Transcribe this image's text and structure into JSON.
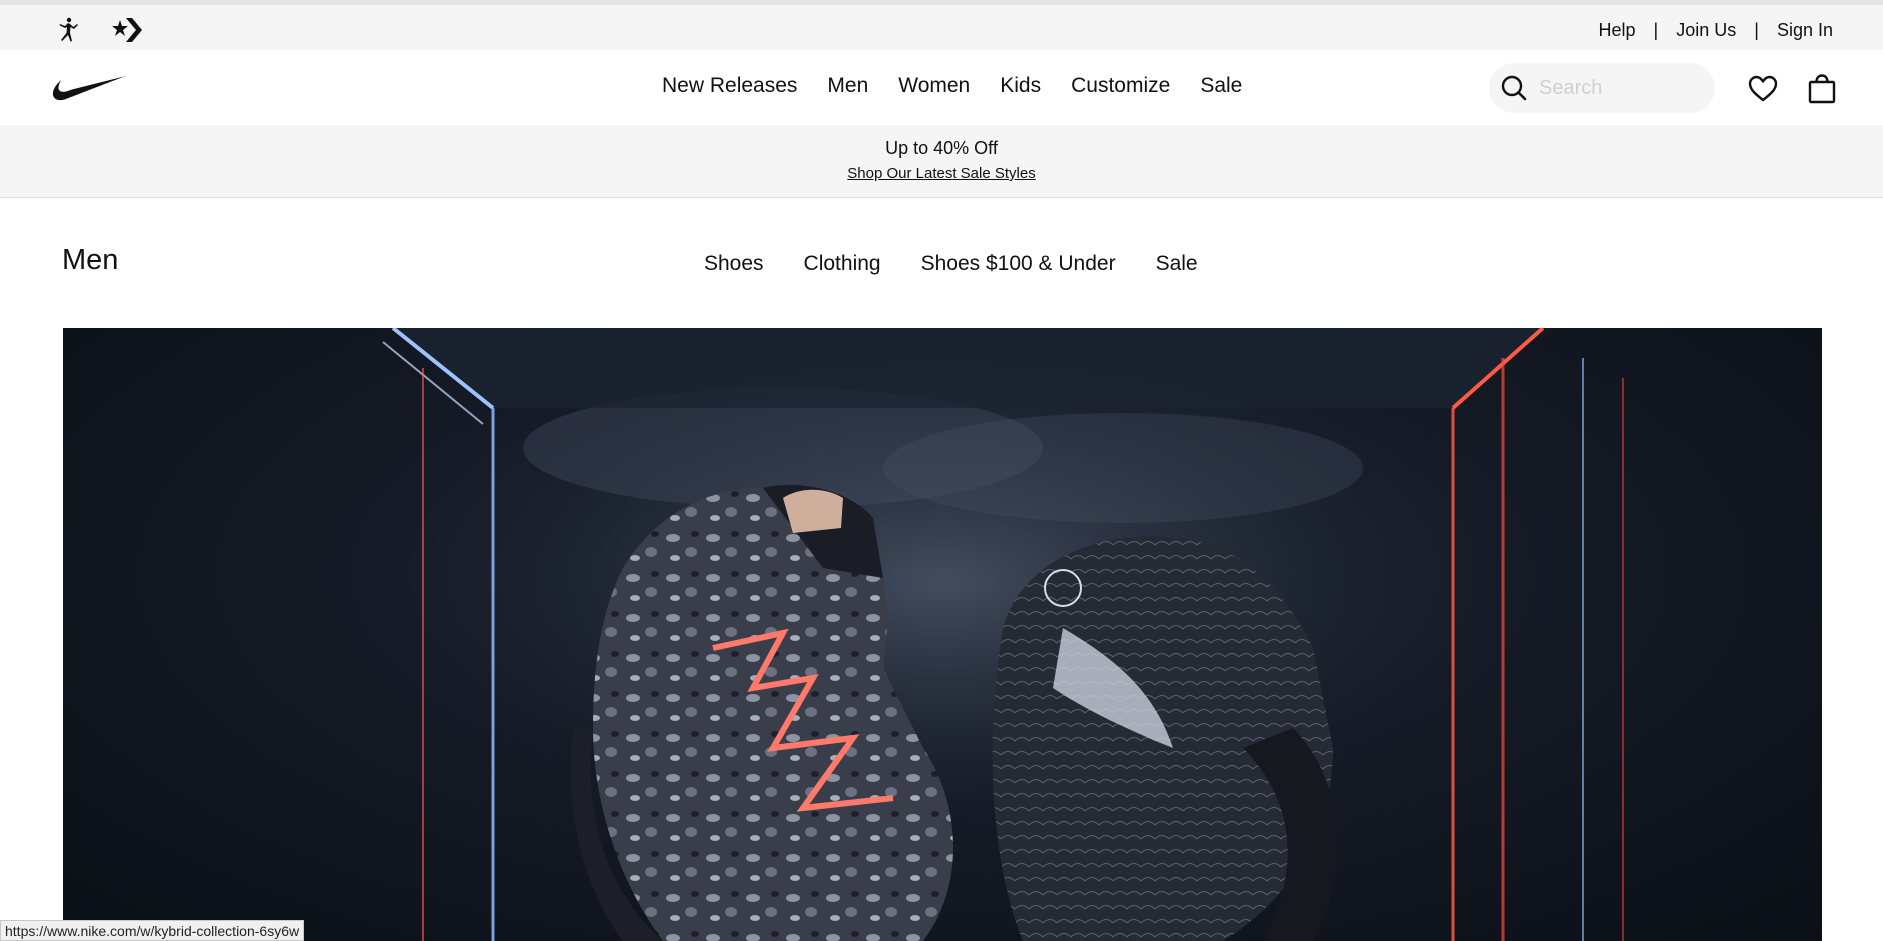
{
  "brand_strip": {
    "icons": [
      "jordan-jumpman-icon",
      "converse-star-chevron-icon"
    ],
    "utility_links": {
      "help": "Help",
      "join": "Join Us",
      "sign_in": "Sign In",
      "separator": "|"
    }
  },
  "main_nav": {
    "logo": "nike-swoosh-icon",
    "items": [
      {
        "label": "New Releases"
      },
      {
        "label": "Men"
      },
      {
        "label": "Women"
      },
      {
        "label": "Kids"
      },
      {
        "label": "Customize"
      },
      {
        "label": "Sale"
      }
    ],
    "search": {
      "placeholder": "Search",
      "value": ""
    },
    "icons": [
      "heart-icon",
      "bag-icon"
    ]
  },
  "promo": {
    "title": "Up to 40% Off",
    "link": "Shop Our Latest Sale Styles"
  },
  "sub_header": {
    "title": "Men",
    "items": [
      {
        "label": "Shoes"
      },
      {
        "label": "Clothing"
      },
      {
        "label": "Shoes $100 & Under"
      },
      {
        "label": "Sale"
      }
    ]
  },
  "status_bar": {
    "url": "https://www.nike.com/w/kybrid-collection-6sy6w"
  },
  "colors": {
    "text": "#111111",
    "strip_bg": "#f5f5f5",
    "accent_red": "#ff4a3a",
    "accent_blue": "#8fb8ff"
  }
}
